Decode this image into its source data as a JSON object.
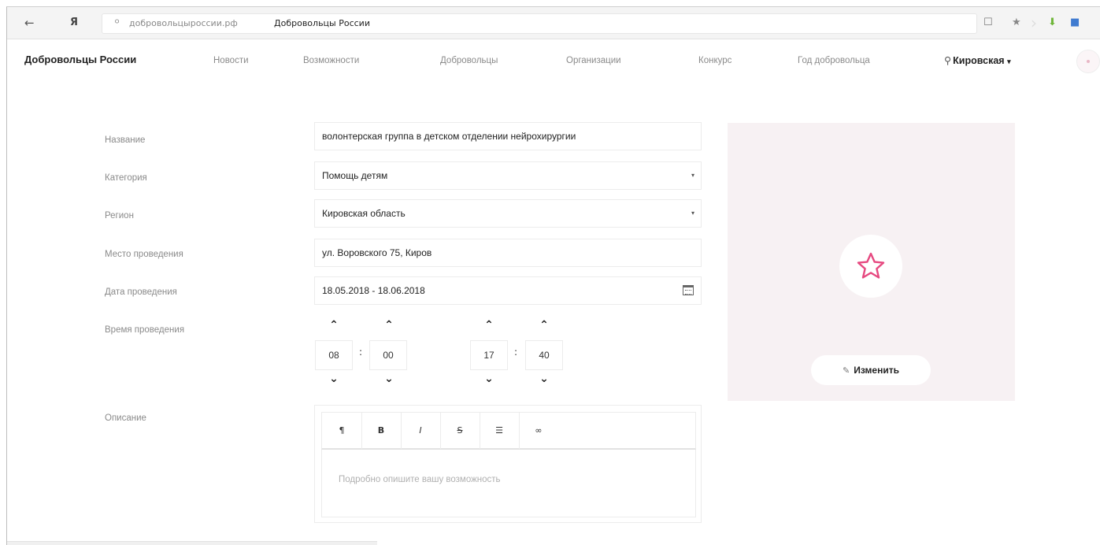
{
  "browser": {
    "back_icon": "←",
    "yandex_logo": "Я",
    "lock_icon": "⚪",
    "url_domain": "добровольцыроссии.рф",
    "page_title": "Добровольцы России",
    "tab_icon": "☐",
    "star_icon": "★",
    "download_icon": "⬇",
    "ext_icon": "■"
  },
  "nav": {
    "brand": "Добровольцы России",
    "links": [
      "Новости",
      "Возможности",
      "Добровольцы",
      "Организации",
      "Конкурс",
      "Год добровольца"
    ],
    "region_pin": "📍",
    "region": "Кировская",
    "region_caret": "▾"
  },
  "form": {
    "name_label": "Название",
    "name_value": "волонтерская группа в детском отделении нейрохирургии",
    "category_label": "Категория",
    "category_value": "Помощь детям",
    "region_label": "Регион",
    "region_value": "Кировская область",
    "place_label": "Место проведения",
    "place_value": "ул. Воровского 75, Киров",
    "date_label": "Дата проведения",
    "date_value": "18.05.2018 - 18.06.2018",
    "time_label": "Время проведения",
    "time": {
      "start_hour": "08",
      "start_minute": "00",
      "end_hour": "17",
      "end_minute": "40",
      "separator": ":",
      "up": "⌃",
      "down": "⌄"
    },
    "desc_label": "Описание",
    "desc_placeholder": "Подробно опишите вашу возможность",
    "select_caret": "▾"
  },
  "editor_toolbar": {
    "paragraph": "¶",
    "bold": "B",
    "italic": "I",
    "strike": "S",
    "list": "☰",
    "link": "∞"
  },
  "image_panel": {
    "change_label": "Изменить",
    "pencil_icon": "✎",
    "accent_color": "#e64980"
  }
}
